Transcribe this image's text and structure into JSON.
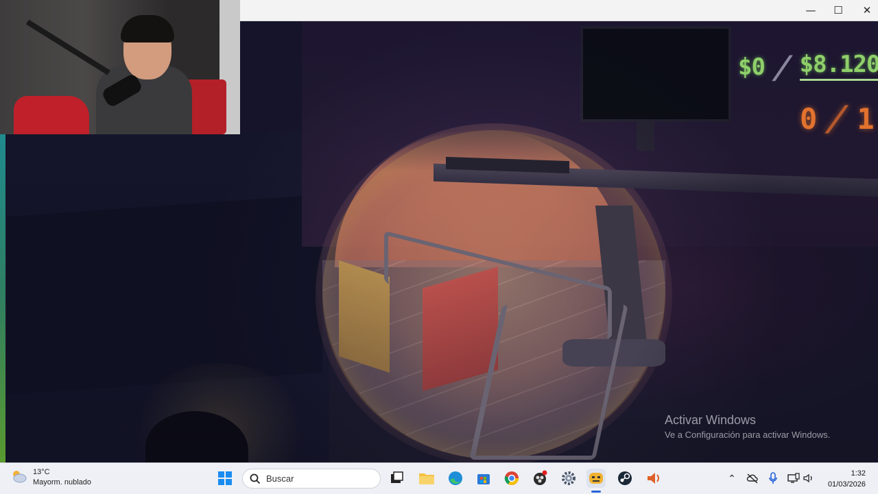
{
  "window": {
    "minimize_glyph": "—",
    "maximize_glyph": "☐",
    "close_glyph": "✕"
  },
  "hud": {
    "money_current": "$0",
    "money_separator": "/",
    "money_target": "$8.120",
    "objective_current": "0",
    "objective_separator": "/",
    "objective_total": "1",
    "colors": {
      "money": "#8fcf6a",
      "objective": "#e2722e"
    }
  },
  "watermark": {
    "title": "Activar Windows",
    "subtitle": "Ve a Configuración para activar Windows."
  },
  "taskbar": {
    "weather": {
      "temperature": "13°C",
      "condition": "Mayorm. nublado",
      "icon": "cloud-sun-icon"
    },
    "start_icon": "windows-start-icon",
    "search_placeholder": "Buscar",
    "pinned_apps": [
      {
        "name": "task-view",
        "icon": "task-view-icon"
      },
      {
        "name": "file-explorer",
        "icon": "folder-icon"
      },
      {
        "name": "edge",
        "icon": "edge-icon"
      },
      {
        "name": "microsoft-store",
        "icon": "store-icon"
      },
      {
        "name": "chrome",
        "icon": "chrome-icon"
      },
      {
        "name": "obs",
        "icon": "obs-icon"
      },
      {
        "name": "settings",
        "icon": "gear-icon"
      },
      {
        "name": "game",
        "icon": "game-app-icon",
        "active": true
      },
      {
        "name": "steam",
        "icon": "steam-icon"
      },
      {
        "name": "audio-app",
        "icon": "speaker-app-icon"
      }
    ],
    "tray": {
      "chevron": "⌃",
      "clock_time": "1:32",
      "clock_date": "01/03/2026"
    }
  }
}
